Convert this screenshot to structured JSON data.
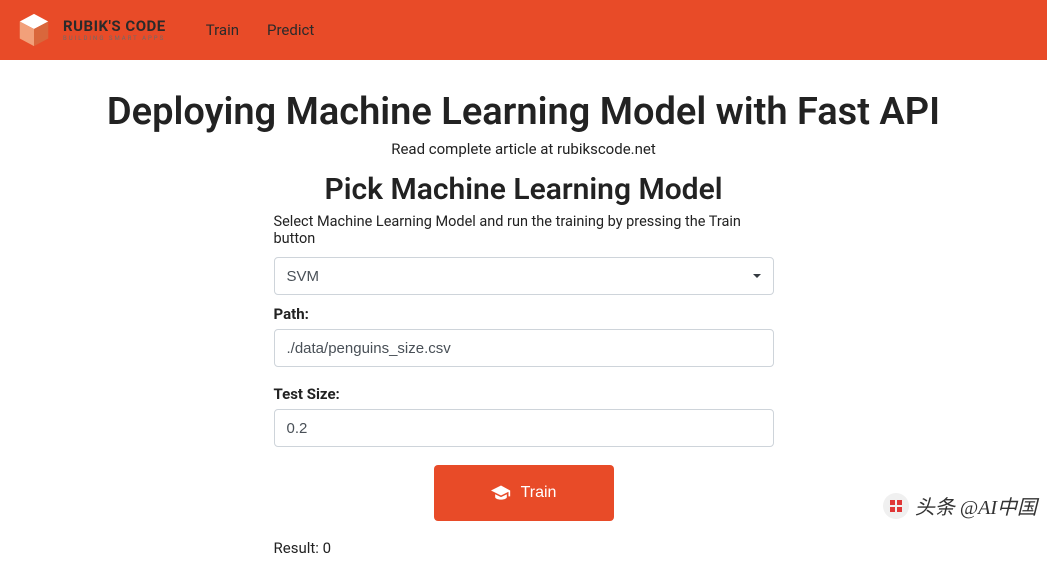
{
  "brand": {
    "title": "RUBIK'S CODE",
    "subtitle": "BUILDING SMART APPS"
  },
  "nav": {
    "train": "Train",
    "predict": "Predict"
  },
  "page": {
    "title": "Deploying Machine Learning Model with Fast API",
    "subtitle": "Read complete article at rubikscode.net"
  },
  "section": {
    "title": "Pick Machine Learning Model",
    "desc": "Select Machine Learning Model and run the training by pressing the Train button"
  },
  "form": {
    "model_selected": "SVM",
    "path_label": "Path:",
    "path_value": "./data/penguins_size.csv",
    "testsize_label": "Test Size:",
    "testsize_value": "0.2",
    "train_button": "Train"
  },
  "result": {
    "text": "Result: 0"
  },
  "watermark": {
    "text": "头条 @AI中国"
  }
}
